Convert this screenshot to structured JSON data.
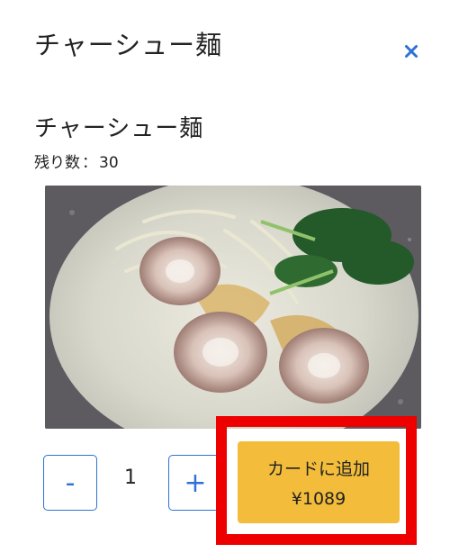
{
  "modal": {
    "title": "チャーシュー麺",
    "close_icon": "close-icon",
    "close_glyph": "×"
  },
  "item": {
    "name": "チャーシュー麺",
    "stock_label": "残り数",
    "stock_separator": "：",
    "stock_count": "30",
    "image_icon": "ramen-photo"
  },
  "quantity": {
    "minus_label": "-",
    "value": "1",
    "plus_label": "+"
  },
  "cart_button": {
    "label": "カードに追加",
    "price": "¥1089"
  },
  "colors": {
    "accent_blue": "#2f72d6",
    "button_yellow": "#f3bd3b",
    "highlight_red": "#ee0000"
  }
}
